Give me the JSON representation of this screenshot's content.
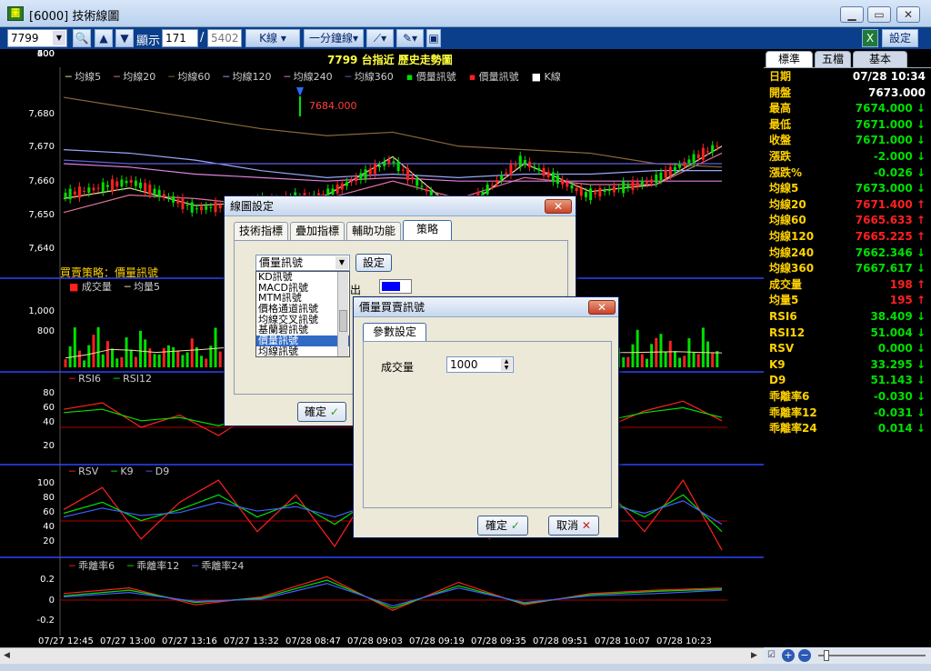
{
  "window": {
    "title": "[6000] 技術線圖",
    "min": "▁",
    "max": "▭",
    "close": "✕"
  },
  "toolbar": {
    "symbol": "7799",
    "display_label": "顯示",
    "display_value": "171",
    "separator": "/",
    "total": "5402",
    "kline": "K線",
    "period": "一分鐘線",
    "settings": "設定",
    "icons": [
      "search-icon",
      "up-arrow-icon",
      "down-arrow-icon",
      "draw-line-icon",
      "eraser-icon",
      "save-icon",
      "excel-icon"
    ]
  },
  "chart_header": {
    "title": "7799  台指近  歷史走勢圖",
    "marker": "7684.000"
  },
  "legends": {
    "price": [
      "均線5",
      "均線20",
      "均線60",
      "均線120",
      "均線240",
      "均線360",
      "價量訊號",
      "價量訊號",
      "K線"
    ],
    "strategy": "買賣策略：價量訊號",
    "volume": [
      "成交量",
      "均量5"
    ],
    "rsi": [
      "RSI6",
      "RSI12"
    ],
    "kd": [
      "RSV",
      "K9",
      "D9"
    ],
    "bias": [
      "乖離率6",
      "乖離率12",
      "乖離率24"
    ]
  },
  "colors": {
    "up": "#ff2020",
    "down": "#00e000",
    "ma5": "#f0e0a0",
    "ma20": "#e070a0",
    "ma60": "#8c6a3a",
    "ma120": "#9aa6ff",
    "ma240": "#e080e0",
    "ma360": "#6060e0",
    "panel_line": "#2b45ff",
    "ref": "#b00000"
  },
  "axes": {
    "price_ticks": [
      "7,680",
      "7,670",
      "7,660",
      "7,650",
      "7,640"
    ],
    "volume_ticks": [
      "1,000",
      "800",
      "600",
      "400",
      "200"
    ],
    "rsi_ticks": [
      "80",
      "60",
      "40",
      "20"
    ],
    "kd_ticks": [
      "100",
      "80",
      "60",
      "40",
      "20"
    ],
    "bias_ticks": [
      "0.2",
      "0",
      "-0.2"
    ],
    "time_ticks": [
      "07/27 12:45",
      "07/27 13:00",
      "07/27 13:16",
      "07/27 13:32",
      "07/28 08:47",
      "07/28 09:03",
      "07/28 09:19",
      "07/28 09:35",
      "07/28 09:51",
      "07/28 10:07",
      "07/28 10:23"
    ]
  },
  "chart_data": {
    "type": "line",
    "title": "7799  台指近  歷史走勢圖",
    "x": [
      "07/27 12:45",
      "07/27 13:00",
      "07/27 13:16",
      "07/27 13:32",
      "07/28 08:47",
      "07/28 09:03",
      "07/28 09:19",
      "07/28 09:35",
      "07/28 09:51",
      "07/28 10:07",
      "07/28 10:23"
    ],
    "series": [
      {
        "name": "K線",
        "values": [
          7658,
          7662,
          7654,
          7656,
          7658,
          7668,
          7652,
          7668,
          7658,
          7662,
          7672
        ]
      },
      {
        "name": "均線5",
        "values": [
          7657,
          7660,
          7655,
          7656,
          7658,
          7669,
          7653,
          7667,
          7659,
          7661,
          7672
        ]
      },
      {
        "name": "均線20",
        "values": [
          7653,
          7658,
          7657,
          7655,
          7657,
          7662,
          7657,
          7663,
          7661,
          7661,
          7670
        ]
      },
      {
        "name": "均線60",
        "values": [
          7686,
          7683,
          7680,
          7677,
          7675,
          7676,
          7672,
          7671,
          7670,
          7667,
          7666
        ]
      },
      {
        "name": "均線120",
        "values": [
          7671,
          7670,
          7668,
          7665,
          7663,
          7664,
          7663,
          7664,
          7664,
          7665,
          7665
        ]
      },
      {
        "name": "均線240",
        "values": [
          7667,
          7666,
          7664,
          7663,
          7662,
          7663,
          7662,
          7662,
          7662,
          7662,
          7662
        ]
      },
      {
        "name": "均線360",
        "values": [
          7668,
          7667,
          7667,
          7667,
          7667,
          7667,
          7667,
          7667,
          7667,
          7667,
          7667
        ]
      }
    ],
    "ylim": [
      7636,
      7692
    ],
    "volume": {
      "name": "成交量",
      "ylim": [
        0,
        1200
      ],
      "values": [
        200,
        350,
        600,
        300,
        150,
        350,
        500,
        800,
        250,
        400,
        300,
        200,
        180,
        450,
        300,
        250,
        600,
        420,
        350,
        280,
        200,
        300,
        450,
        380,
        250,
        200,
        350,
        500,
        300,
        200
      ]
    },
    "rsi": {
      "ylim": [
        0,
        100
      ],
      "RSI6": [
        62,
        70,
        40,
        55,
        30,
        60,
        75,
        45,
        80,
        50,
        65,
        35,
        70,
        55,
        40,
        60,
        72,
        48
      ],
      "RSI12": [
        58,
        62,
        48,
        52,
        42,
        56,
        64,
        50,
        68,
        54,
        60,
        45,
        62,
        55,
        48,
        58,
        64,
        52
      ]
    },
    "kd": {
      "ylim": [
        0,
        110
      ],
      "RSV": [
        60,
        90,
        20,
        70,
        100,
        30,
        80,
        10,
        95,
        40,
        70,
        20,
        85,
        50,
        90,
        30,
        100,
        5
      ],
      "K9": [
        55,
        70,
        45,
        60,
        80,
        50,
        70,
        40,
        75,
        55,
        65,
        40,
        70,
        55,
        75,
        50,
        80,
        30
      ],
      "D9": [
        50,
        62,
        52,
        56,
        70,
        58,
        64,
        50,
        68,
        58,
        62,
        48,
        64,
        56,
        68,
        55,
        72,
        40
      ]
    },
    "bias": {
      "ylim": [
        -0.3,
        0.3
      ],
      "乖離率6": [
        0.05,
        0.1,
        -0.05,
        0.02,
        0.2,
        -0.1,
        0.15,
        -0.05,
        0.05,
        0.08,
        0.1
      ],
      "乖離率12": [
        0.03,
        0.08,
        -0.03,
        0.01,
        0.17,
        -0.08,
        0.12,
        -0.04,
        0.04,
        0.07,
        0.09
      ],
      "乖離率24": [
        0.02,
        0.06,
        -0.02,
        0.0,
        0.14,
        -0.06,
        0.1,
        -0.03,
        0.03,
        0.05,
        0.08
      ]
    }
  },
  "right_panel": {
    "tabs": [
      "標準",
      "五檔",
      "基本"
    ],
    "rows": [
      {
        "label": "日期",
        "value": "07/28 10:34",
        "color": "#ffffff"
      },
      {
        "label": "開盤",
        "value": "7673.000",
        "color": "#ffffff"
      },
      {
        "label": "最高",
        "value": "7674.000 ↓",
        "color": "#00e000"
      },
      {
        "label": "最低",
        "value": "7671.000 ↓",
        "color": "#00e000"
      },
      {
        "label": "收盤",
        "value": "7671.000 ↓",
        "color": "#00e000"
      },
      {
        "label": "漲跌",
        "value": "-2.000 ↓",
        "color": "#00e000"
      },
      {
        "label": "漲跌%",
        "value": "-0.026 ↓",
        "color": "#00e000"
      },
      {
        "label": "均線5",
        "value": "7673.000 ↓",
        "color": "#00e000"
      },
      {
        "label": "均線20",
        "value": "7671.400 ↑",
        "color": "#ff2020"
      },
      {
        "label": "均線60",
        "value": "7665.633 ↑",
        "color": "#ff2020"
      },
      {
        "label": "均線120",
        "value": "7665.225 ↑",
        "color": "#ff2020"
      },
      {
        "label": "均線240",
        "value": "7662.346 ↓",
        "color": "#00e000"
      },
      {
        "label": "均線360",
        "value": "7667.617 ↓",
        "color": "#00e000"
      },
      {
        "label": "成交量",
        "value": "198 ↑",
        "color": "#ff2020"
      },
      {
        "label": "均量5",
        "value": "195 ↑",
        "color": "#ff2020"
      },
      {
        "label": "RSI6",
        "value": "38.409 ↓",
        "color": "#00e000"
      },
      {
        "label": "RSI12",
        "value": "51.004 ↓",
        "color": "#00e000"
      },
      {
        "label": "RSV",
        "value": "0.000 ↓",
        "color": "#00e000"
      },
      {
        "label": "K9",
        "value": "33.295 ↓",
        "color": "#00e000"
      },
      {
        "label": "D9",
        "value": "51.143 ↓",
        "color": "#00e000"
      },
      {
        "label": "乖離率6",
        "value": "-0.030 ↓",
        "color": "#00e000"
      },
      {
        "label": "乖離率12",
        "value": "-0.031 ↓",
        "color": "#00e000"
      },
      {
        "label": "乖離率24",
        "value": "0.014 ↓",
        "color": "#00e000"
      }
    ]
  },
  "dialog_main": {
    "title": "線圖設定",
    "tabs": [
      "技術指標",
      "疊加指標",
      "輔助功能",
      "策略"
    ],
    "selected": "價量訊號",
    "settings_btn": "設定",
    "list": [
      "KD訊號",
      "MACD訊號",
      "MTM訊號",
      "價格通道訊號",
      "均線交叉訊號",
      "基蘭碧訊號",
      "價量訊號",
      "均線訊號"
    ],
    "hidden_label": "出",
    "ok": "確定"
  },
  "dialog_sub": {
    "title": "價量買賣訊號",
    "tab": "參數設定",
    "field_label": "成交量",
    "field_value": "1000",
    "ok": "確定",
    "cancel": "取消"
  }
}
